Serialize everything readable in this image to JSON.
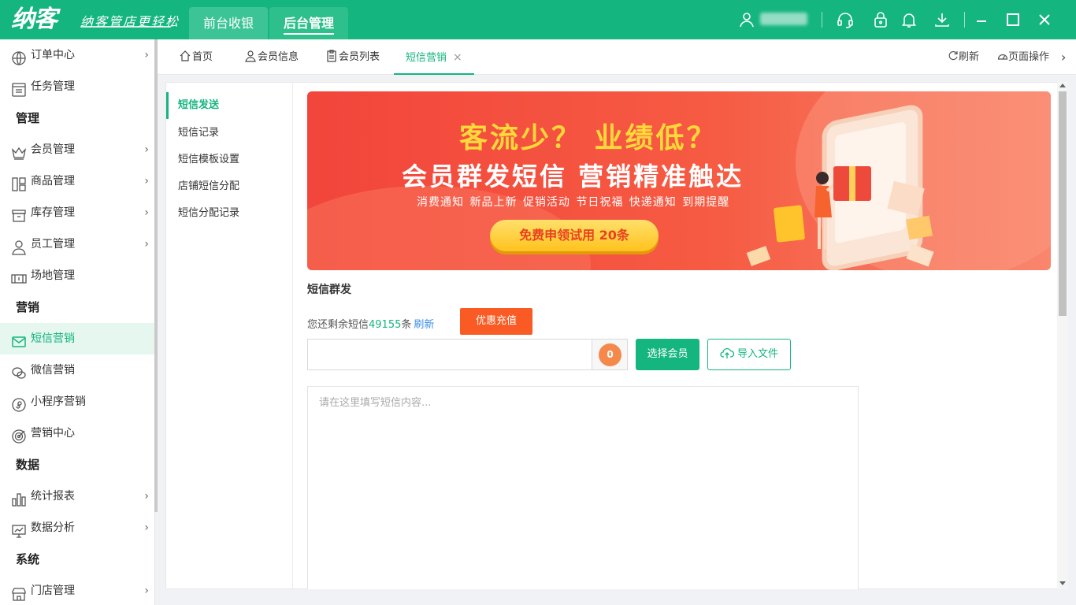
{
  "app": {
    "logo": "纳客",
    "slogan": "纳客管店更轻松",
    "top_tabs": [
      {
        "label": "前台收银"
      },
      {
        "label": "后台管理"
      }
    ]
  },
  "sidebar": {
    "items": [
      {
        "label": "订单中心",
        "icon": "globe-icon",
        "has_arrow": true
      },
      {
        "label": "任务管理",
        "icon": "task-list-icon",
        "has_arrow": false
      },
      {
        "label": "会员管理",
        "icon": "crown-icon",
        "has_arrow": true
      },
      {
        "label": "商品管理",
        "icon": "grid-icon",
        "has_arrow": true
      },
      {
        "label": "库存管理",
        "icon": "inventory-box-icon",
        "has_arrow": true
      },
      {
        "label": "员工管理",
        "icon": "user-icon",
        "has_arrow": true
      },
      {
        "label": "场地管理",
        "icon": "venue-icon",
        "has_arrow": false
      },
      {
        "label": "短信营销",
        "icon": "mail-icon",
        "has_arrow": false
      },
      {
        "label": "微信营销",
        "icon": "wechat-icon",
        "has_arrow": false
      },
      {
        "label": "小程序营销",
        "icon": "mini-program-icon",
        "has_arrow": false
      },
      {
        "label": "营销中心",
        "icon": "target-icon",
        "has_arrow": false
      },
      {
        "label": "统计报表",
        "icon": "bar-chart-icon",
        "has_arrow": true
      },
      {
        "label": "数据分析",
        "icon": "monitor-chart-icon",
        "has_arrow": true
      },
      {
        "label": "门店管理",
        "icon": "store-icon",
        "has_arrow": true
      }
    ],
    "groups": [
      "管理",
      "营销",
      "数据",
      "系统"
    ]
  },
  "page_tabs": [
    {
      "label": "首页",
      "icon": "home-icon"
    },
    {
      "label": "会员信息",
      "icon": "user-icon"
    },
    {
      "label": "会员列表",
      "icon": "clipboard-icon"
    },
    {
      "label": "短信营销",
      "close": "×"
    }
  ],
  "toolbar": {
    "refresh": "刷新",
    "page_ops": "页面操作",
    "more": "›"
  },
  "submenu": [
    {
      "label": "短信发送"
    },
    {
      "label": "短信记录"
    },
    {
      "label": "短信模板设置"
    },
    {
      "label": "店铺短信分配"
    },
    {
      "label": "短信分配记录"
    }
  ],
  "banner": {
    "headline": "客流少？ 业绩低？",
    "subheadline": "会员群发短信 营销精准触达",
    "tags": "消费通知  新品上新  促销活动  节日祝福  快递通知  到期提醒",
    "cta": "免费申领试用 20条"
  },
  "sms": {
    "section_title": "短信群发",
    "remain_prefix": "您还剩余短信",
    "remain_count": "49155",
    "remain_suffix": "条",
    "refresh": "刷新",
    "recharge": "优惠充值",
    "member_count": "0",
    "select_member": "选择会员",
    "import_file": "导入文件",
    "content_placeholder": "请在这里填写短信内容..."
  },
  "colors": {
    "brand": "#14b57f",
    "recharge": "#fa5a23",
    "badge": "#f4894b"
  }
}
